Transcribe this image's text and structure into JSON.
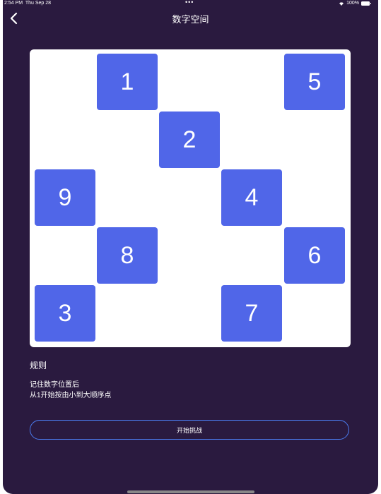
{
  "status_bar": {
    "time": "2:54 PM",
    "date": "Thu Sep 28",
    "dots": "•••",
    "battery": "100%"
  },
  "nav": {
    "title": "数字空间"
  },
  "board": {
    "tiles": [
      "1",
      "5",
      "2",
      "9",
      "4",
      "8",
      "6",
      "3",
      "7"
    ]
  },
  "rules": {
    "title": "规则",
    "line1": "记住数字位置后",
    "line2": "从1开始按由小到大顺序点"
  },
  "start_button": {
    "label": "开始挑战"
  },
  "colors": {
    "background": "#2a1a3f",
    "tile": "#5066e8",
    "button_border": "#4b7cf0"
  }
}
